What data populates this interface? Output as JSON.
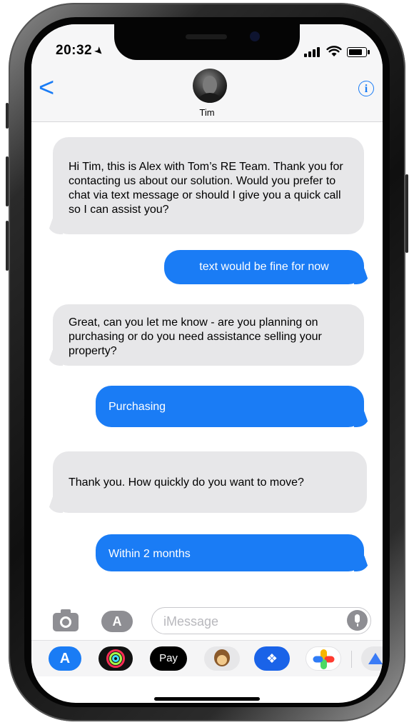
{
  "status_bar": {
    "time": "20:32"
  },
  "header": {
    "back_glyph": "<",
    "contact_name": "Tim",
    "info_glyph": "i"
  },
  "messages": [
    {
      "direction": "incoming",
      "text": "Hi Tim, this is Alex with Tom’s RE Team. Thank you for contacting us about our solution.  Would you prefer to chat via text message or should I give you a quick call so I can assist you?"
    },
    {
      "direction": "outgoing",
      "text": "text would be fine for now"
    },
    {
      "direction": "incoming",
      "text": "Great, can you let me know - are you planning on purchasing or do you need assistance selling your property?"
    },
    {
      "direction": "outgoing",
      "text": "Purchasing"
    },
    {
      "direction": "incoming",
      "text": "Thank you. How quickly do you want to move?"
    },
    {
      "direction": "outgoing",
      "text": "Within 2 months"
    }
  ],
  "composer": {
    "placeholder": "iMessage"
  },
  "app_drawer": {
    "apps": [
      {
        "name": "app-store-icon"
      },
      {
        "name": "activity-icon"
      },
      {
        "name": "apple-pay-icon",
        "label": "Pay"
      },
      {
        "name": "animoji-icon"
      },
      {
        "name": "dropbox-icon"
      },
      {
        "name": "photos-icon"
      },
      {
        "name": "more-apps-icon"
      }
    ]
  },
  "colors": {
    "accent": "#1a7cf5",
    "incoming_bubble": "#e7e7e9",
    "outgoing_bubble": "#1a7cf5"
  }
}
